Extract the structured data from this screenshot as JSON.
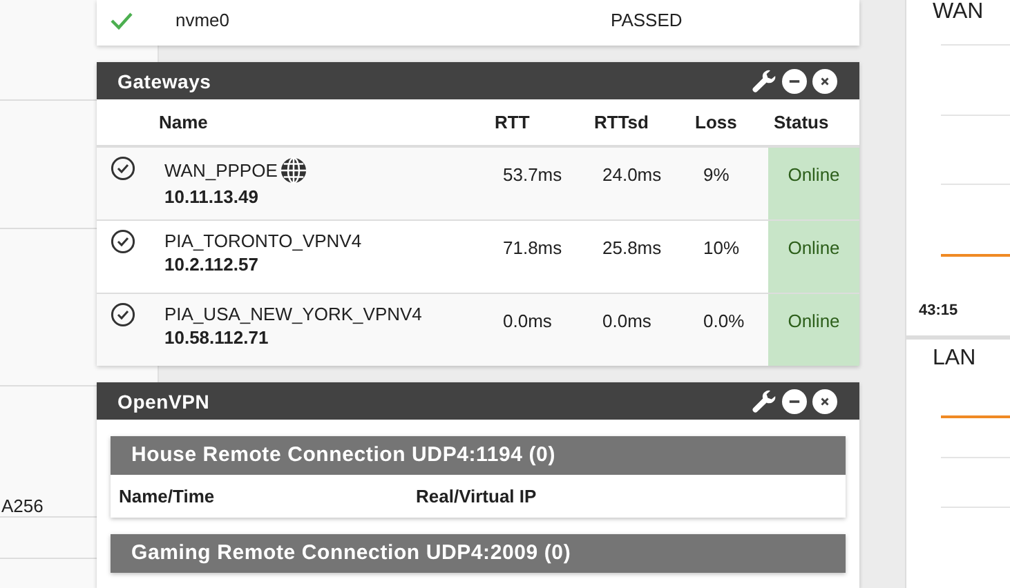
{
  "left_panel": {
    "rows": [
      {
        "text": ""
      },
      {
        "text": ""
      },
      {
        "text": ""
      },
      {
        "text": "A256"
      },
      {
        "text": ""
      }
    ]
  },
  "disks": {
    "rows": [
      {
        "ok": true,
        "device": "nvme0",
        "status": "PASSED"
      }
    ]
  },
  "gateways": {
    "title": "Gateways",
    "columns": [
      "Name",
      "RTT",
      "RTTsd",
      "Loss",
      "Status"
    ],
    "rows": [
      {
        "name": "WAN_PPPOE",
        "globe": true,
        "address": "10.11.13.49",
        "rtt": "53.7ms",
        "rttsd": "24.0ms",
        "loss": "9%",
        "status": "Online"
      },
      {
        "name": "PIA_TORONTO_VPNV4",
        "globe": false,
        "address": "10.2.112.57",
        "rtt": "71.8ms",
        "rttsd": "25.8ms",
        "loss": "10%",
        "status": "Online"
      },
      {
        "name": "PIA_USA_NEW_YORK_VPNV4",
        "globe": false,
        "address": "10.58.112.71",
        "rtt": "0.0ms",
        "rttsd": "0.0ms",
        "loss": "0.0%",
        "status": "Online"
      }
    ]
  },
  "openvpn": {
    "title": "OpenVPN",
    "servers": [
      {
        "title": "House Remote Connection UDP4:1194 (0)",
        "columns": [
          "Name/Time",
          "Real/Virtual IP"
        ]
      },
      {
        "title": "Gaming Remote Connection UDP4:2009 (0)"
      }
    ]
  },
  "traffic": {
    "graphs": [
      {
        "label": "WAN",
        "time": "43:15"
      },
      {
        "label": "LAN"
      }
    ]
  }
}
